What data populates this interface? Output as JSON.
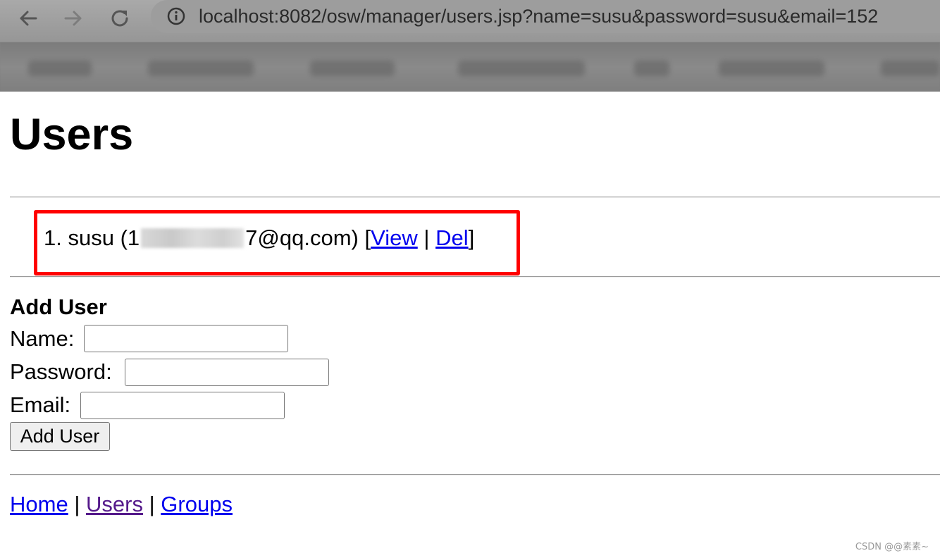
{
  "browser": {
    "url": "localhost:8082/osw/manager/users.jsp?name=susu&password=susu&email=152",
    "back_icon": "arrow-left-icon",
    "forward_icon": "arrow-right-icon",
    "reload_icon": "reload-icon",
    "info_icon": "info-icon"
  },
  "page": {
    "title": "Users"
  },
  "user_list": {
    "items": [
      {
        "index": "1.",
        "name": "susu",
        "email_prefix": "(1",
        "email_suffix": "7@qq.com)",
        "open_bracket": "[",
        "view_label": "View",
        "separator": "|",
        "del_label": "Del",
        "close_bracket": "]"
      }
    ]
  },
  "form": {
    "heading": "Add User",
    "name_label": "Name:",
    "name_value": "",
    "password_label": "Password:",
    "password_value": "",
    "email_label": "Email:",
    "email_value": "",
    "submit_label": "Add User"
  },
  "footer": {
    "home_label": "Home",
    "users_label": "Users",
    "groups_label": "Groups",
    "separator": "|"
  },
  "watermark": "CSDN @@素素~",
  "colors": {
    "link": "#0000ee",
    "visited_link": "#551a8b",
    "highlight": "#ff0000"
  }
}
